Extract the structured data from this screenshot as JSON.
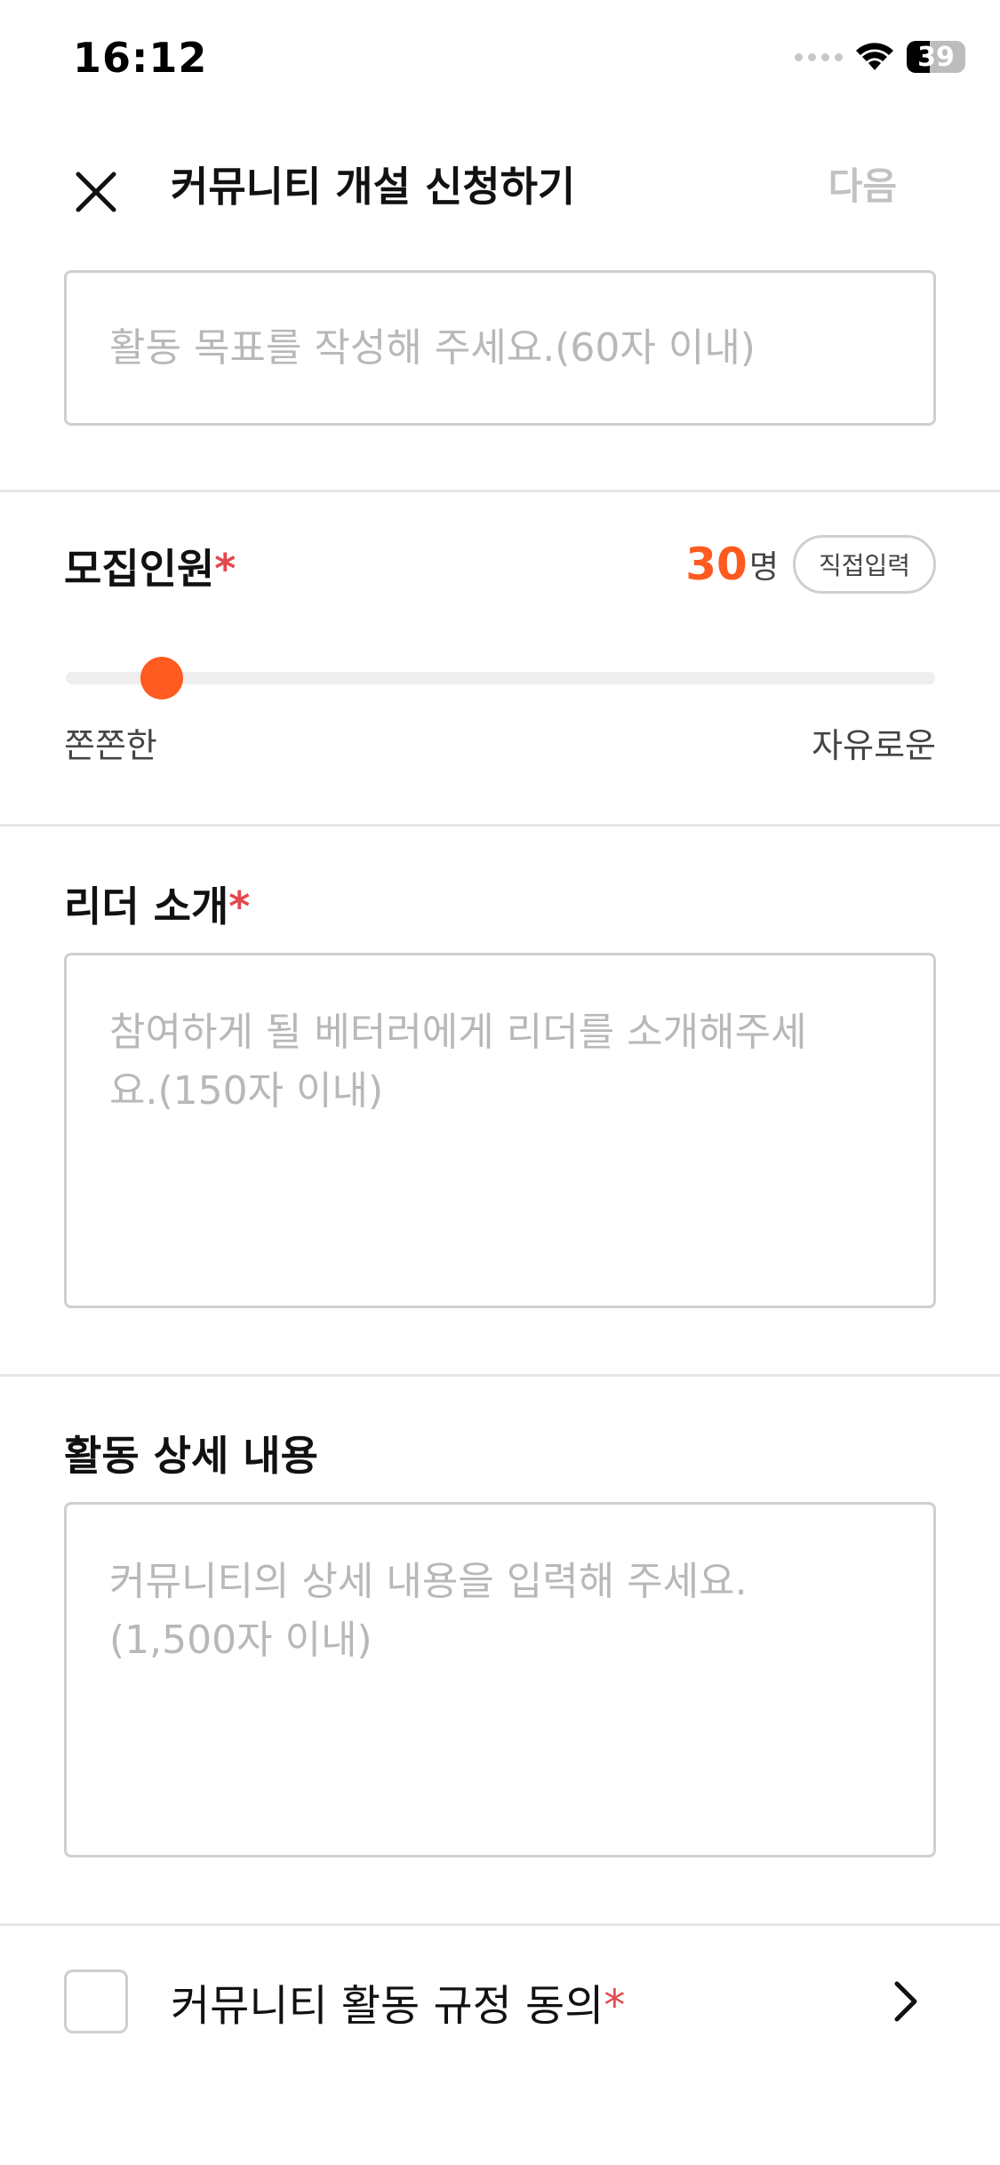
{
  "status_bar": {
    "time": "16:12",
    "battery": 39
  },
  "header": {
    "title": "커뮤니티 개설 신청하기",
    "next_label": "다음"
  },
  "goal": {
    "placeholder": "활동 목표를 작성해 주세요.(60자 이내)"
  },
  "recruit": {
    "title": "모집인원",
    "required": "*",
    "count": "30",
    "unit": "명",
    "direct_input_label": "직접입력",
    "slider_value": 0.11,
    "min_label": "쫀쫀한",
    "max_label": "자유로운"
  },
  "leader": {
    "title": "리더 소개",
    "required": "*",
    "placeholder_line1": "참여하게 될 베터러에게 리더를 소개해주세",
    "placeholder_line2": "요.(150자 이내)"
  },
  "details": {
    "title": "활동 상세 내용",
    "placeholder_line1": "커뮤니티의 상세 내용을 입력해 주세요.",
    "placeholder_line2": "(1,500자 이내)"
  },
  "agreement": {
    "label": "커뮤니티 활동 규정 동의",
    "required": "*"
  },
  "colors": {
    "accent": "#ff5a1f",
    "required": "#e5484d",
    "placeholder": "#b8b8b8"
  }
}
